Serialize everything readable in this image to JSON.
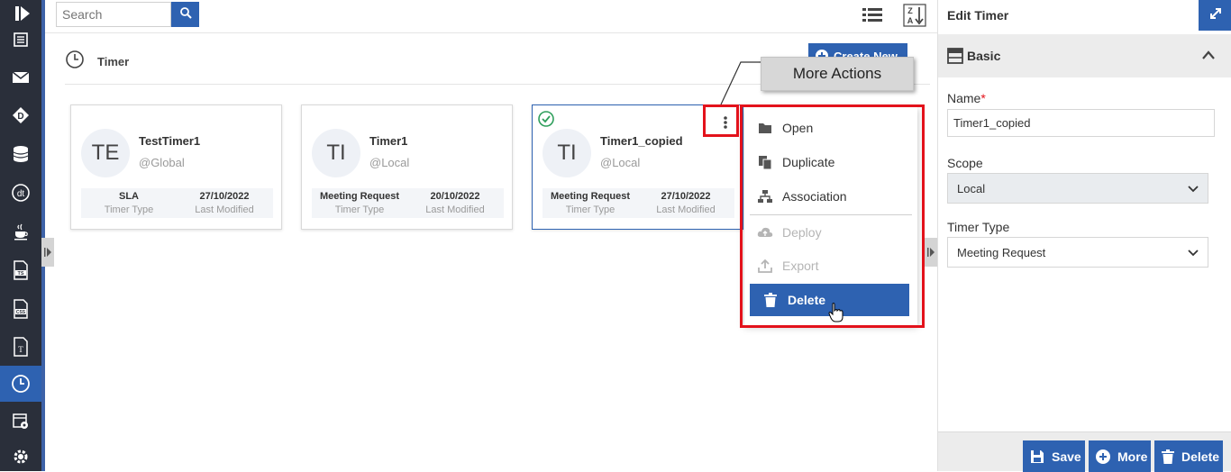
{
  "sidebar": {
    "items": [
      "logo-icon",
      "document-list-icon",
      "mail-icon",
      "diamond-d-icon",
      "database-icon",
      "dt-icon",
      "java-cup-icon",
      "ts-file-icon",
      "css-file-icon",
      "text-file-icon",
      "clock-icon",
      "report-settings-icon",
      "gear-settings-icon"
    ],
    "active": "clock-icon"
  },
  "search": {
    "placeholder": "Search"
  },
  "header": {
    "title": "Timer",
    "create_label": "Create New"
  },
  "cards": [
    {
      "initials": "TE",
      "name": "TestTimer1",
      "scope": "@Global",
      "timer_type": "SLA",
      "timer_type_caption": "Timer Type",
      "last_modified": "27/10/2022",
      "last_modified_caption": "Last Modified",
      "selected": false
    },
    {
      "initials": "TI",
      "name": "Timer1",
      "scope": "@Local",
      "timer_type": "Meeting Request",
      "timer_type_caption": "Timer Type",
      "last_modified": "20/10/2022",
      "last_modified_caption": "Last Modified",
      "selected": false
    },
    {
      "initials": "TI",
      "name": "Timer1_copied",
      "scope": "@Local",
      "timer_type": "Meeting Request",
      "timer_type_caption": "Timer Type",
      "last_modified": "27/10/2022",
      "last_modified_caption": "Last Modified",
      "selected": true
    }
  ],
  "menu": {
    "items": [
      {
        "label": "Open",
        "icon": "folder-icon",
        "enabled": true
      },
      {
        "label": "Duplicate",
        "icon": "copy-icon",
        "enabled": true
      },
      {
        "label": "Association",
        "icon": "sitemap-icon",
        "enabled": true
      },
      {
        "label": "Deploy",
        "icon": "cloud-upload-icon",
        "enabled": false
      },
      {
        "label": "Export",
        "icon": "export-icon",
        "enabled": false
      },
      {
        "label": "Delete",
        "icon": "trash-icon",
        "enabled": true,
        "highlighted": true
      }
    ]
  },
  "annotation": {
    "callout": "More Actions",
    "color": "#e3121b"
  },
  "panel": {
    "title": "Edit Timer",
    "section": "Basic",
    "name_label": "Name",
    "name_required": "*",
    "name_value": "Timer1_copied",
    "scope_label": "Scope",
    "scope_value": "Local",
    "timer_type_label": "Timer Type",
    "timer_type_value": "Meeting Request",
    "save_label": "Save",
    "more_label": "More",
    "delete_label": "Delete"
  },
  "colors": {
    "accent": "#2e62b1",
    "sidebar": "#2a2f3a",
    "highlight": "#e3121b"
  }
}
